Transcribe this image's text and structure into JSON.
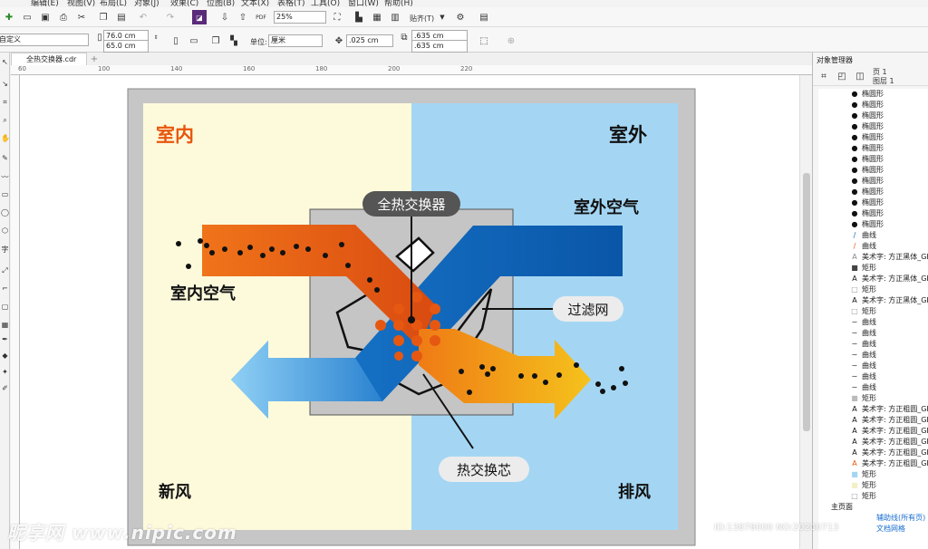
{
  "menu": [
    "编辑(E)",
    "视图(V)",
    "布局(L)",
    "对象(J)",
    "效果(C)",
    "位图(B)",
    "文本(X)",
    "表格(T)",
    "工具(O)",
    "窗口(W)",
    "帮助(H)"
  ],
  "toolbar": {
    "zoom_value": "25%",
    "snap_label": "贴齐(T)",
    "preset_value": "自定义",
    "width_value": "76.0 cm",
    "height_value": "65.0 cm",
    "unit_label": "单位:",
    "unit_value": "厘米",
    "nudge_value": ".025 cm",
    "dup_x_value": ".635 cm",
    "dup_y_value": ".635 cm",
    "pdf_label": "PDF"
  },
  "document_tab": {
    "label": "全热交换器.cdr"
  },
  "ruler": {
    "ticks": [
      "60",
      "80",
      "100",
      "120",
      "140",
      "160",
      "180",
      "200",
      "220"
    ],
    "first_tick": "140"
  },
  "artwork": {
    "indoor_label": "室内",
    "outdoor_label": "室外",
    "title_label": "全热交换器",
    "outdoor_air_label": "室外空气",
    "indoor_air_label": "室内空气",
    "filter_label": "过滤网",
    "core_label": "热交换芯",
    "fresh_air_label": "新风",
    "exhaust_label": "排风",
    "colors": {
      "indoor_bg": "#fdfadb",
      "outdoor_bg": "#a4d6f4",
      "orange": "#e8560e",
      "blue": "#1466b5",
      "frame": "#c6c6c6"
    }
  },
  "panel": {
    "title": "对象管理器",
    "page_label": "页 1",
    "layer_label": "图层 1",
    "items": [
      {
        "icon": "ellipse",
        "label": "椭圆形"
      },
      {
        "icon": "ellipse",
        "label": "椭圆形"
      },
      {
        "icon": "ellipse",
        "label": "椭圆形"
      },
      {
        "icon": "ellipse",
        "label": "椭圆形"
      },
      {
        "icon": "ellipse",
        "label": "椭圆形"
      },
      {
        "icon": "ellipse",
        "label": "椭圆形"
      },
      {
        "icon": "ellipse",
        "label": "椭圆形"
      },
      {
        "icon": "ellipse",
        "label": "椭圆形"
      },
      {
        "icon": "ellipse",
        "label": "椭圆形"
      },
      {
        "icon": "ellipse",
        "label": "椭圆形"
      },
      {
        "icon": "ellipse",
        "label": "椭圆形"
      },
      {
        "icon": "ellipse",
        "label": "椭圆形"
      },
      {
        "icon": "ellipse",
        "label": "椭圆形"
      },
      {
        "icon": "curve-blue",
        "label": "曲线"
      },
      {
        "icon": "curve-orange",
        "label": "曲线"
      },
      {
        "icon": "text-outline",
        "label": "美术字: 方正黑体_GB"
      },
      {
        "icon": "rect-dark",
        "label": "矩形"
      },
      {
        "icon": "text",
        "label": "美术字: 方正黑体_GB"
      },
      {
        "icon": "rect-light",
        "label": "矩形"
      },
      {
        "icon": "text",
        "label": "美术字: 方正黑体_GB"
      },
      {
        "icon": "rect-light",
        "label": "矩形"
      },
      {
        "icon": "curve",
        "label": "曲线"
      },
      {
        "icon": "curve",
        "label": "曲线"
      },
      {
        "icon": "curve",
        "label": "曲线"
      },
      {
        "icon": "curve",
        "label": "曲线"
      },
      {
        "icon": "curve",
        "label": "曲线"
      },
      {
        "icon": "curve",
        "label": "曲线"
      },
      {
        "icon": "curve",
        "label": "曲线"
      },
      {
        "icon": "rect-gray",
        "label": "矩形"
      },
      {
        "icon": "text",
        "label": "美术字: 方正粗圆_GB"
      },
      {
        "icon": "text",
        "label": "美术字: 方正粗圆_GB"
      },
      {
        "icon": "text",
        "label": "美术字: 方正粗圆_GB"
      },
      {
        "icon": "text",
        "label": "美术字: 方正粗圆_GB"
      },
      {
        "icon": "text",
        "label": "美术字: 方正粗圆_GB"
      },
      {
        "icon": "text-orange",
        "label": "美术字: 方正粗圆_GB"
      },
      {
        "icon": "rect-blue",
        "label": "矩形"
      },
      {
        "icon": "rect-cream",
        "label": "矩形"
      },
      {
        "icon": "rect-light",
        "label": "矩形"
      }
    ],
    "master_page": "主页面",
    "guides_label": "辅助线(所有页)",
    "desktop_label": "文档网格"
  },
  "watermark": {
    "site": "昵享网 www.nipic.com",
    "id": "ID:13878000 NO:20200713"
  }
}
